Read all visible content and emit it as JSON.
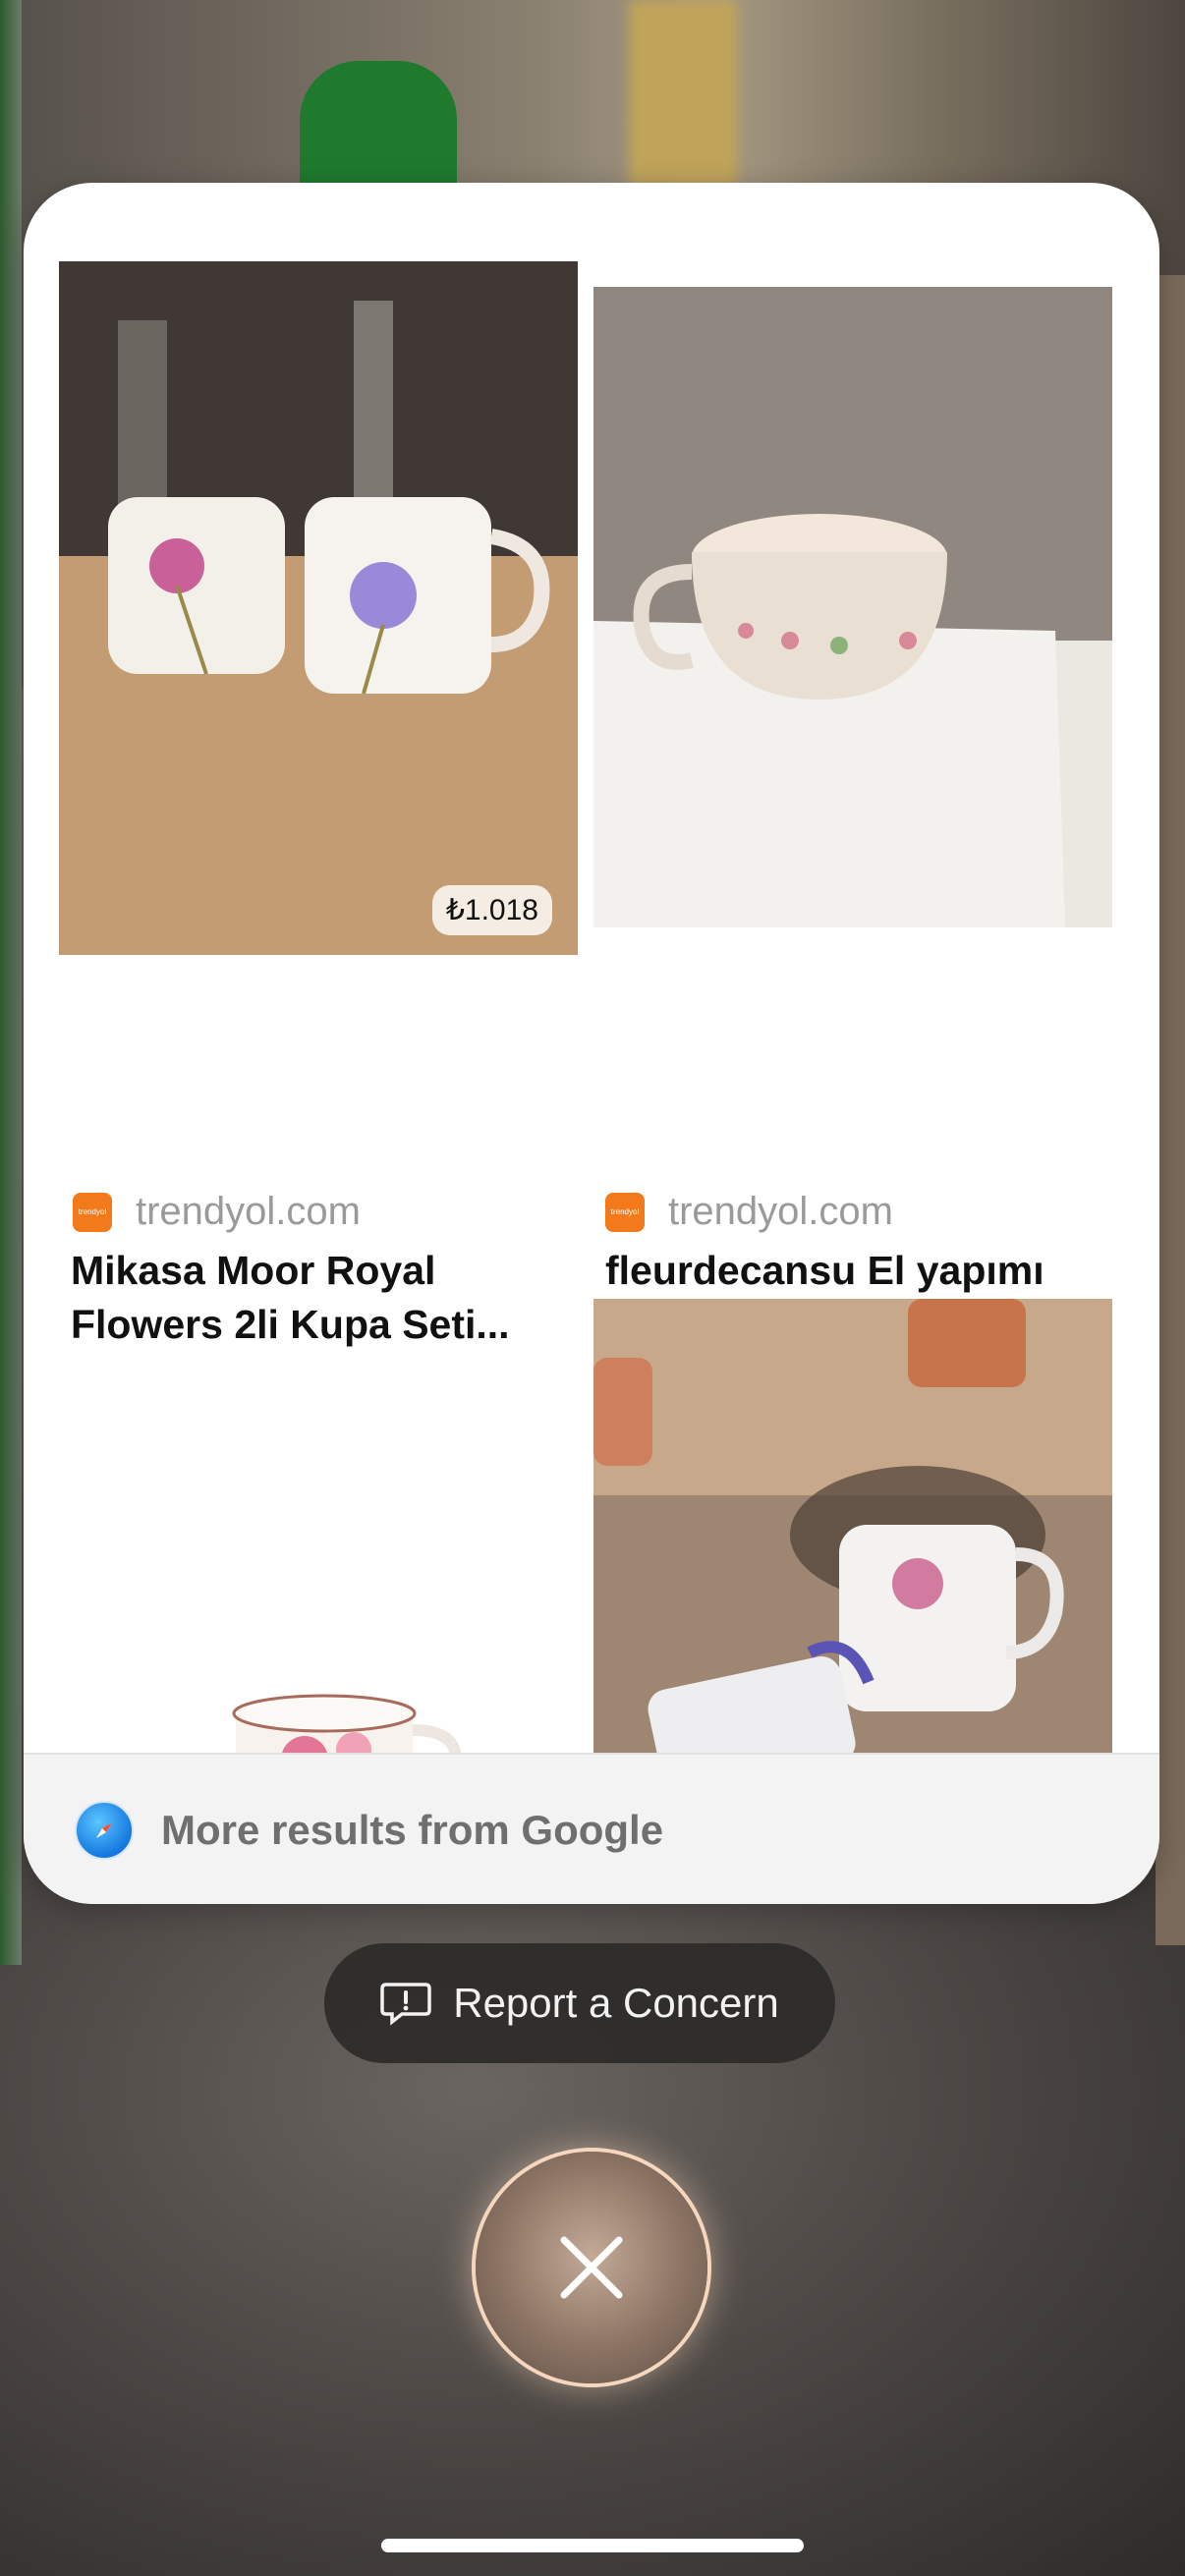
{
  "results": [
    {
      "source": "trendyol.com",
      "title": "Mikasa Moor Royal Flowers 2li Kupa Seti...",
      "price": "₺1.018",
      "thumbnail_icon": "two-flower-mugs-photo"
    },
    {
      "source": "trendyol.com",
      "title": "fleurdecansu El yapımı seramik anneler gunu...",
      "thumbnail_icon": "ceramic-cup-photo"
    },
    {
      "thumbnail_icon": "flower-teacup-photo"
    },
    {
      "thumbnail_icon": "mugs-on-table-photo"
    }
  ],
  "favicon_text": "trendyol",
  "more_results": {
    "label": "More results from Google",
    "icon": "safari-compass-icon"
  },
  "report": {
    "label": "Report a Concern",
    "icon": "report-bubble-icon"
  },
  "close_icon": "close-icon",
  "colors": {
    "favicon": "#f27a1a",
    "card": "#ffffff",
    "more_bar": "#f3f3f3"
  }
}
